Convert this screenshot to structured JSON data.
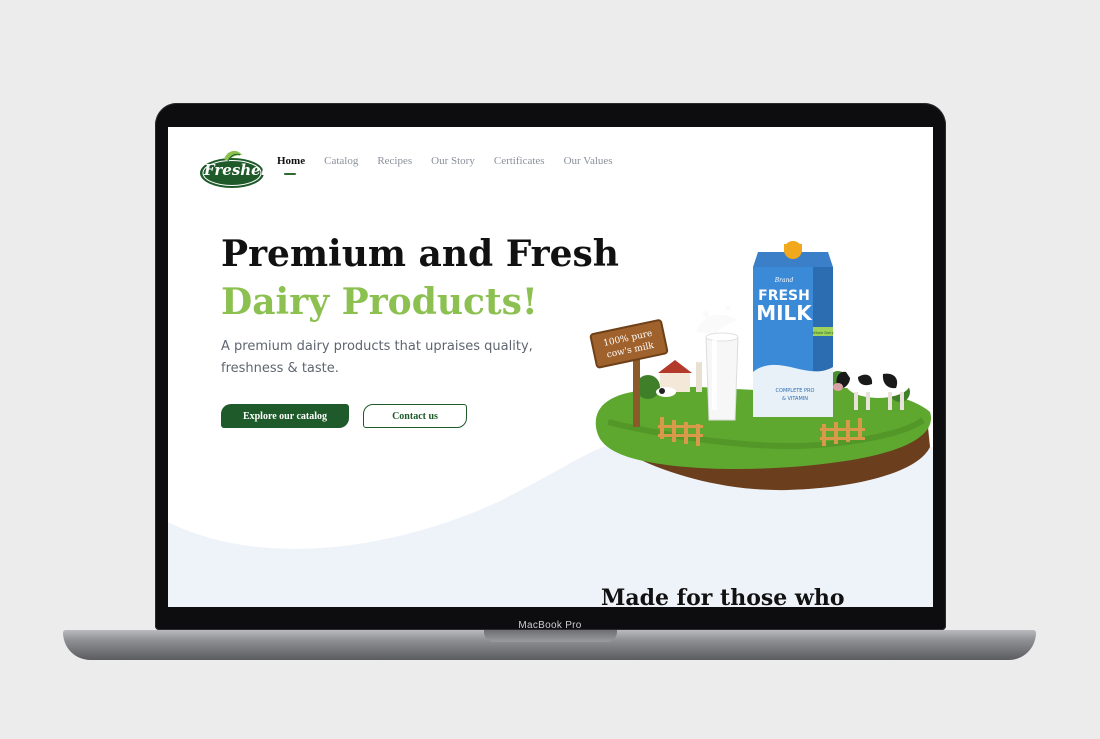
{
  "device": {
    "label": "MacBook Pro"
  },
  "site": {
    "logo_text": "Fresher",
    "nav": [
      {
        "label": "Home",
        "active": true
      },
      {
        "label": "Catalog",
        "active": false
      },
      {
        "label": "Recipes",
        "active": false
      },
      {
        "label": "Our Story",
        "active": false
      },
      {
        "label": "Certificates",
        "active": false
      },
      {
        "label": "Our Values",
        "active": false
      }
    ]
  },
  "hero": {
    "title_line1": "Premium and Fresh",
    "title_line2": "Dairy Products!",
    "subtitle": "A premium dairy products that upraises quality, freshness & taste.",
    "primary_button": "Explore our catalog",
    "secondary_button": "Contact us",
    "art": {
      "carton_brand": "Brand",
      "carton_title_line1": "FRESH",
      "carton_title_line2": "MILK",
      "carton_tag": "Whole Dairy",
      "carton_side_line1": "COMPLETE PRO",
      "carton_side_line2": "& VITAMIN",
      "sign_line1": "100% pure",
      "sign_line2": "cow's milk"
    }
  },
  "next_section": {
    "heading": "Made for those who"
  },
  "colors": {
    "brand_green": "#1e5a2a",
    "accent_green": "#8cc152",
    "wave_bg": "#eef3fa"
  }
}
